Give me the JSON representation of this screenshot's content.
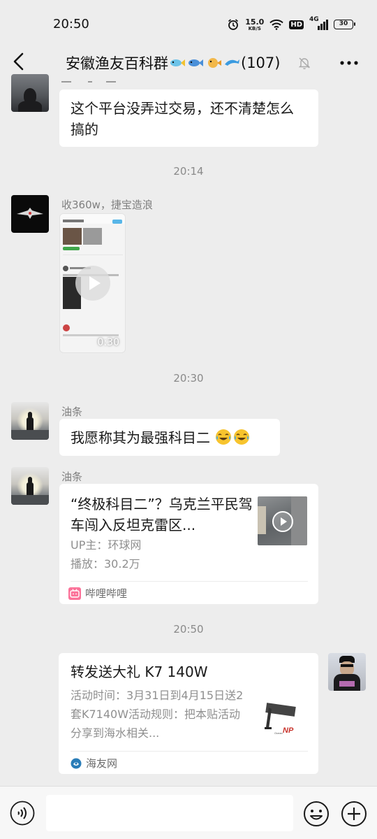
{
  "status_bar": {
    "time": "20:50",
    "net_speed_value": "15.0",
    "net_speed_unit": "KB/S",
    "hd": "HD",
    "network": "4G",
    "battery": "30",
    "icons": [
      "alarm-icon",
      "wifi-icon",
      "signal-icon",
      "battery-icon"
    ]
  },
  "header": {
    "title": "安徽渔友百科群",
    "member_count": "(107)",
    "icons": [
      "back-icon",
      "fish-emoji",
      "mute-icon",
      "more-icon"
    ]
  },
  "messages": [
    {
      "type": "text",
      "text": "这个平台没弄过交易，还不清楚怎么搞的"
    },
    {
      "type": "timestamp",
      "text": "20:14"
    },
    {
      "type": "video",
      "sender": "收360w，捷宝造浪",
      "duration": "0:30"
    },
    {
      "type": "timestamp",
      "text": "20:30"
    },
    {
      "type": "text",
      "sender": "油条",
      "text": "我愿称其为最强科目二",
      "emoji": "😂😂"
    },
    {
      "type": "link_card",
      "sender": "油条",
      "title": "“终极科目二”？乌克兰平民驾车闯入反坦克雷区...",
      "uploader": "UP主：环球网",
      "plays": "播放：30.2万",
      "source": "哔哩哔哩"
    },
    {
      "type": "timestamp",
      "text": "20:50"
    },
    {
      "type": "link_card_self",
      "title": "转发送大礼 K7 140W",
      "description": "活动时间：3月31日到4月15日送2套K7140W活动规则：把本贴活动分享到海水相关...",
      "source": "海友网"
    }
  ],
  "input_bar": {
    "placeholder": "",
    "icons": [
      "voice-icon",
      "emoji-icon",
      "plus-icon"
    ]
  },
  "colors": {
    "background": "#ededed",
    "bubble": "#ffffff",
    "meta_text": "#8f8f8f",
    "bilibili_pink": "#fb7299",
    "haiyou_blue": "#2a7db8"
  }
}
